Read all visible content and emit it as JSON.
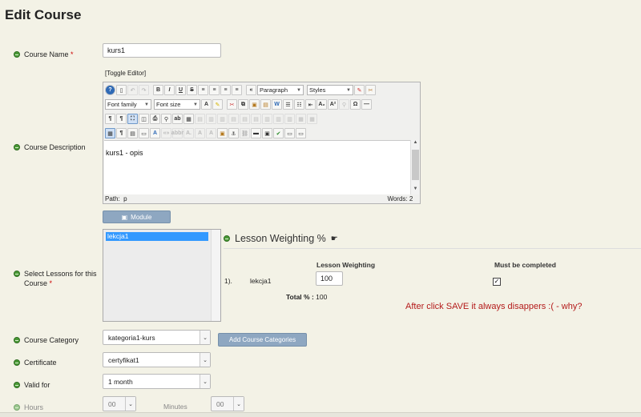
{
  "page_title": "Edit Course",
  "course_name": {
    "label": "Course Name",
    "required_mark": "*",
    "value": "kurs1"
  },
  "course_description": {
    "label": "Course Description",
    "toggle_label": "[Toggle Editor]",
    "format_select": "Paragraph",
    "styles_select": "Styles",
    "font_family_select": "Font family",
    "font_size_select": "Font size",
    "content": "kurs1 - opis",
    "path_label": "Path:",
    "path_value": "p",
    "words_label": "Words:",
    "words_value": "2"
  },
  "module_button": "Module",
  "lessons": {
    "label": "Select Lessons for this Course",
    "required_mark": "*",
    "items": [
      "lekcja1"
    ]
  },
  "lesson_weighting": {
    "heading": "Lesson Weighting %",
    "col_weighting": "Lesson Weighting",
    "col_completed": "Must be completed",
    "rows": [
      {
        "index": "1).",
        "name": "lekcja1",
        "weight": "100",
        "completed": true
      }
    ],
    "total_label": "Total % :",
    "total_value": "100"
  },
  "note": "After click SAVE it always disappers :( - why?",
  "course_category": {
    "label": "Course Category",
    "value": "kategoria1-kurs",
    "add_button": "Add Course Categories"
  },
  "certificate": {
    "label": "Certificate",
    "value": "certyfikat1"
  },
  "valid_for": {
    "label": "Valid for",
    "value": "1 month"
  },
  "hours": {
    "label": "Hours",
    "value": "00"
  },
  "minutes": {
    "label": "Minutes",
    "value": "00"
  },
  "colors": {
    "accent_button": "#8ea7c1",
    "note_red": "#b41a1a",
    "selection_blue": "#3399ff",
    "background": "#f3f2e6"
  }
}
